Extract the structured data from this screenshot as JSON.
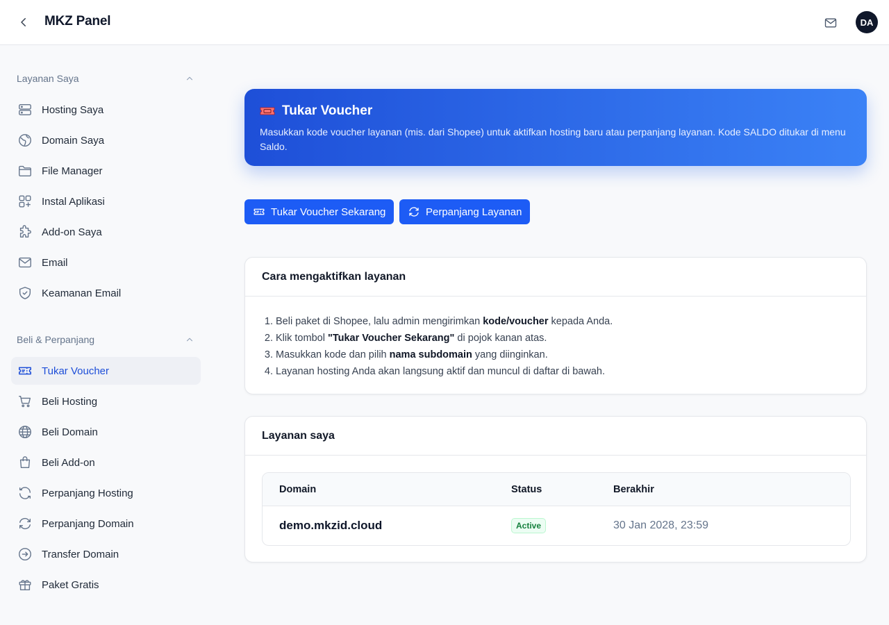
{
  "header": {
    "title": "MKZ Panel",
    "avatar_initials": "DA"
  },
  "sidebar": {
    "group1": {
      "label": "Layanan Saya",
      "items": [
        {
          "label": "Hosting Saya",
          "icon": "server-icon"
        },
        {
          "label": "Domain Saya",
          "icon": "globe-grid-icon"
        },
        {
          "label": "File Manager",
          "icon": "folder-icon"
        },
        {
          "label": "Instal Aplikasi",
          "icon": "apps-plus-icon"
        },
        {
          "label": "Add-on Saya",
          "icon": "puzzle-icon"
        },
        {
          "label": "Email",
          "icon": "mail-icon"
        },
        {
          "label": "Keamanan Email",
          "icon": "shield-check-icon"
        }
      ]
    },
    "group2": {
      "label": "Beli & Perpanjang",
      "items": [
        {
          "label": "Tukar Voucher",
          "icon": "ticket-icon",
          "active": true
        },
        {
          "label": "Beli Hosting",
          "icon": "cart-icon"
        },
        {
          "label": "Beli Domain",
          "icon": "globe-icon"
        },
        {
          "label": "Beli Add-on",
          "icon": "shopping-bag-icon"
        },
        {
          "label": "Perpanjang Hosting",
          "icon": "refresh-icon"
        },
        {
          "label": "Perpanjang Domain",
          "icon": "refresh-alt-icon"
        },
        {
          "label": "Transfer Domain",
          "icon": "arrow-circle-right-icon"
        },
        {
          "label": "Paket Gratis",
          "icon": "gift-icon"
        }
      ]
    }
  },
  "hero": {
    "title": "Tukar Voucher",
    "description": "Masukkan kode voucher layanan (mis. dari Shopee) untuk aktifkan hosting baru atau perpanjang layanan. Kode SALDO ditukar di menu Saldo."
  },
  "actions": {
    "redeem_label": "Tukar Voucher Sekarang",
    "renew_label": "Perpanjang Layanan"
  },
  "howto": {
    "title": "Cara mengaktifkan layanan",
    "steps": [
      {
        "before": "Beli paket di Shopee, lalu admin mengirimkan ",
        "bold": "kode/voucher",
        "after": " kepada Anda."
      },
      {
        "before": "Klik tombol ",
        "bold": "\"Tukar Voucher Sekarang\"",
        "after": " di pojok kanan atas."
      },
      {
        "before": "Masukkan kode dan pilih ",
        "bold": "nama subdomain",
        "after": " yang diinginkan."
      },
      {
        "before": "Layanan hosting Anda akan langsung aktif dan muncul di daftar di bawah.",
        "bold": "",
        "after": ""
      }
    ]
  },
  "services": {
    "title": "Layanan saya",
    "columns": {
      "domain": "Domain",
      "status": "Status",
      "expires": "Berakhir"
    },
    "rows": [
      {
        "domain": "demo.mkzid.cloud",
        "status": "Active",
        "expires": "30 Jan 2028, 23:59"
      }
    ]
  },
  "colors": {
    "primary": "#1d5cf5",
    "active_text": "#1d4ed8",
    "success": "#15803d"
  }
}
